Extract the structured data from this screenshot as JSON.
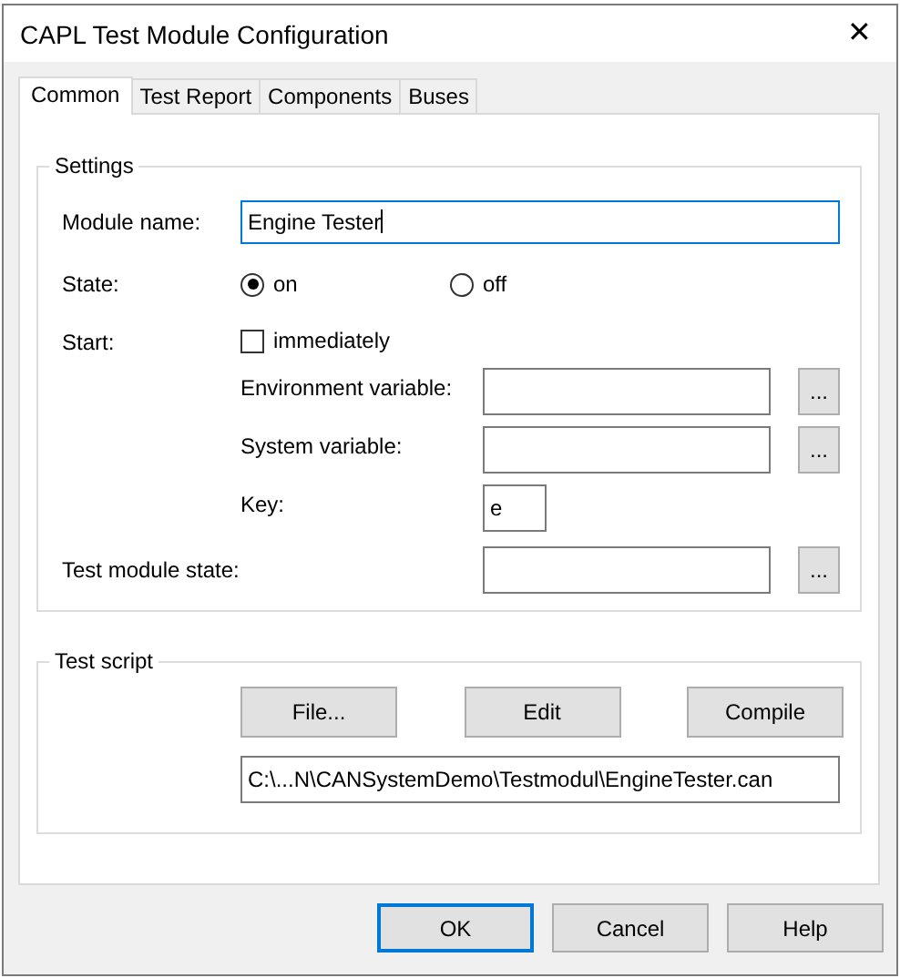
{
  "window": {
    "title": "CAPL Test Module Configuration",
    "close": "✕"
  },
  "tabs": [
    {
      "label": "Common",
      "selected": true
    },
    {
      "label": "Test Report",
      "selected": false
    },
    {
      "label": "Components",
      "selected": false
    },
    {
      "label": "Buses",
      "selected": false
    }
  ],
  "settings": {
    "title": "Settings",
    "module_name_label": "Module name:",
    "module_name": "Engine Tester",
    "state_label": "State:",
    "state_options": [
      {
        "label": "on",
        "selected": true
      },
      {
        "label": "off",
        "selected": false
      }
    ],
    "start_label": "Start:",
    "immediately": {
      "label": "immediately",
      "checked": false
    },
    "variables": [
      {
        "label": "Environment variable:",
        "browse": "..."
      },
      {
        "label": "System variable:",
        "browse": "..."
      }
    ],
    "key_label": "Key:",
    "key": "e",
    "test_module_state_label": "Test module state:",
    "test_module_state_browse": "..."
  },
  "test_script": {
    "title": "Test script",
    "buttons": [
      "File...",
      "Edit",
      "Compile"
    ],
    "path": "C:\\...N\\CANSystemDemo\\Testmodul\\EngineTester.can"
  },
  "buttons": [
    {
      "label": "OK",
      "default": true
    },
    {
      "label": "Cancel",
      "default": false
    },
    {
      "label": "Help",
      "default": false
    }
  ]
}
